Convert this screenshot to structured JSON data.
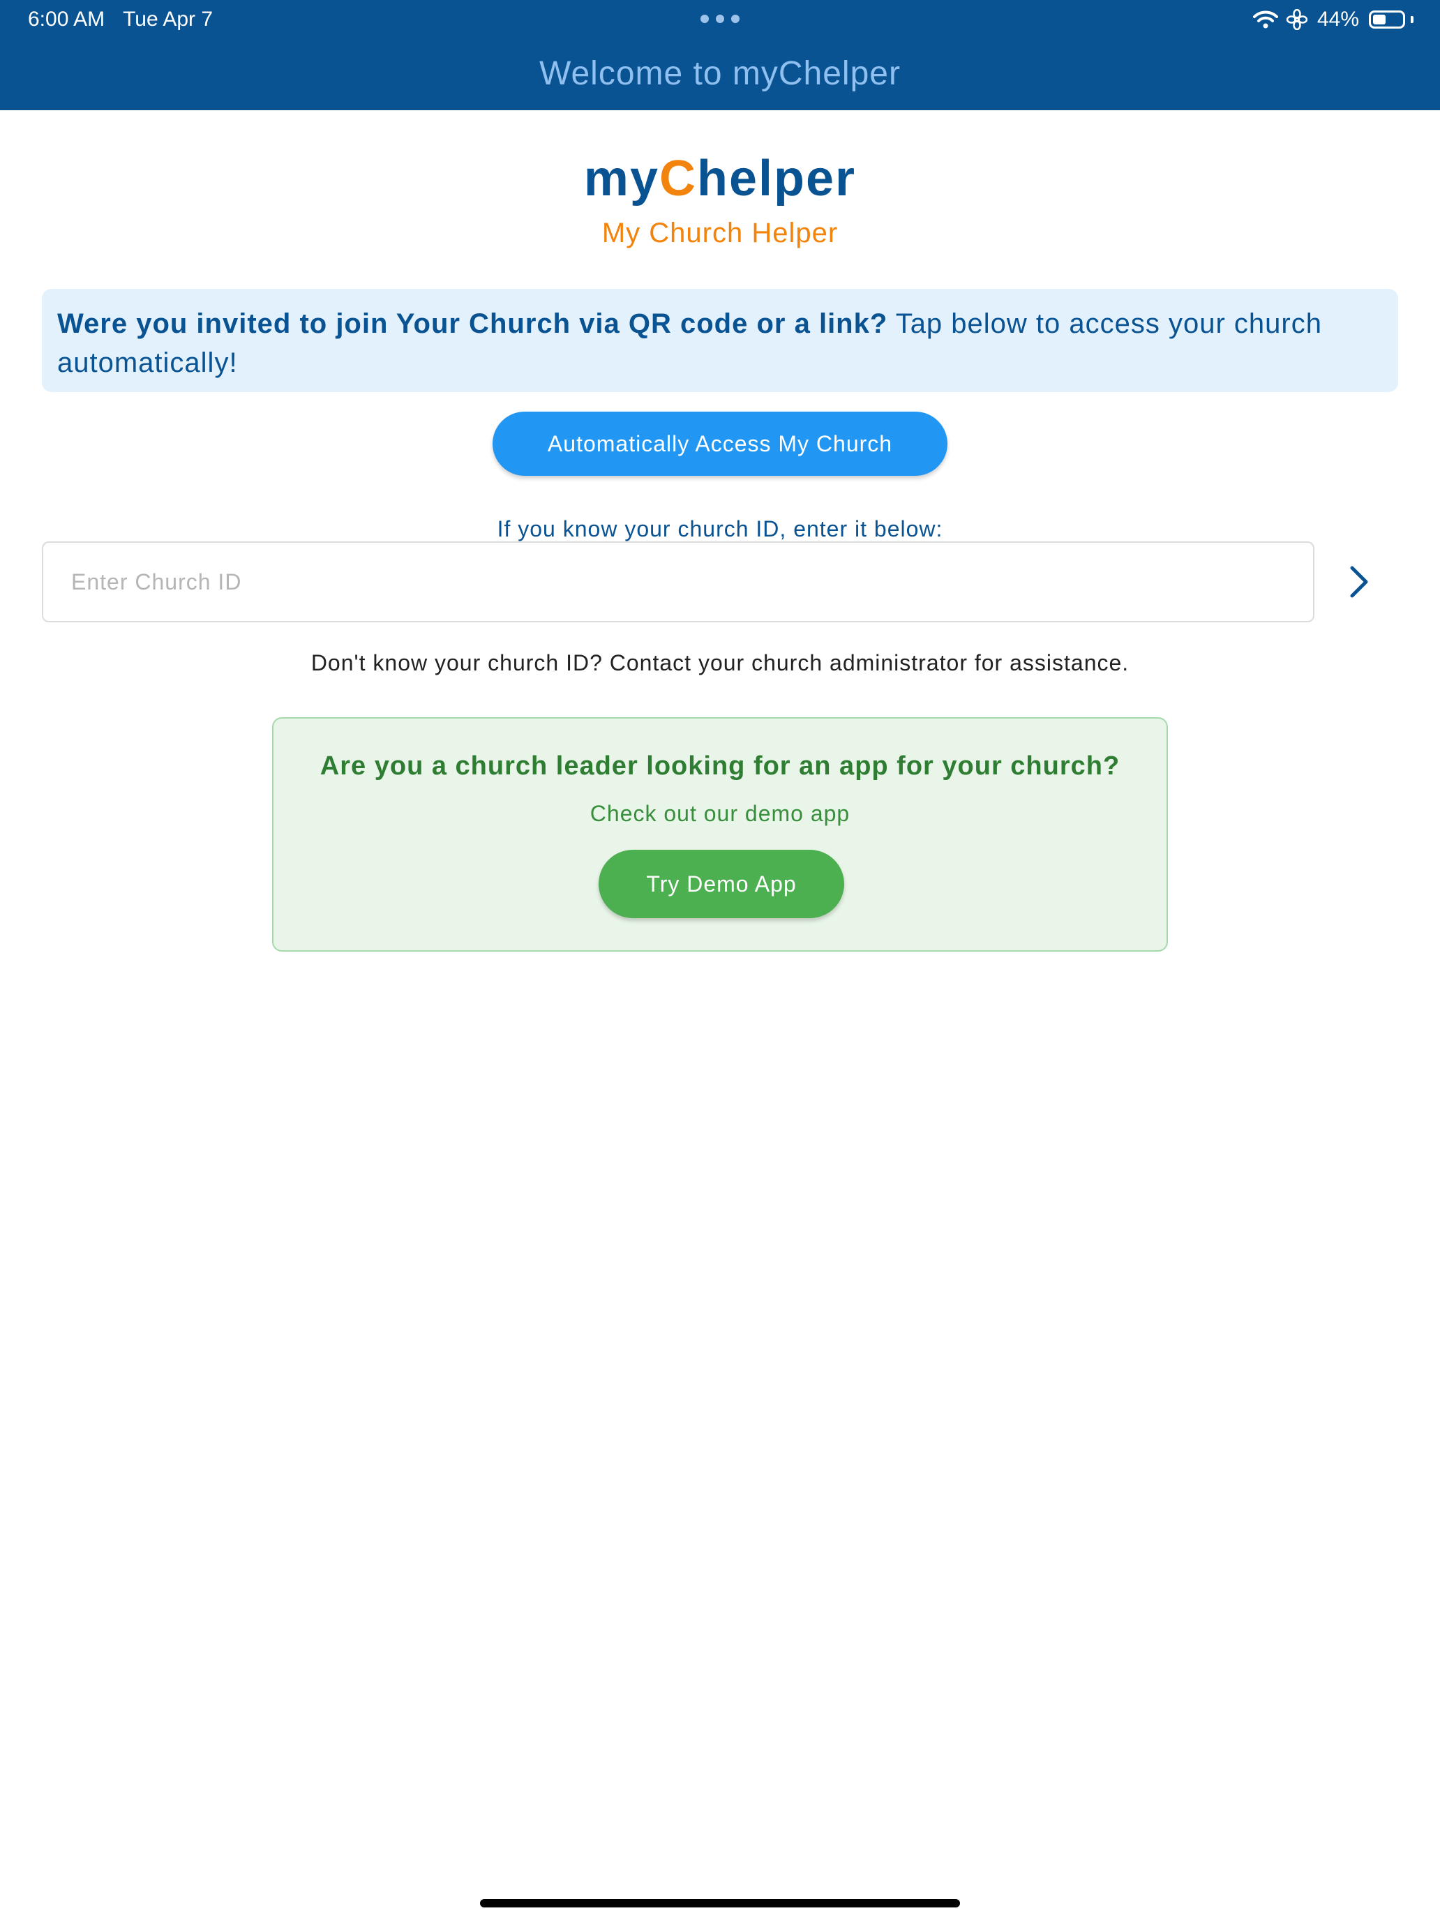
{
  "status_bar": {
    "time": "6:00 AM",
    "date": "Tue Apr 7",
    "battery_percent_label": "44%",
    "battery_level": 0.44,
    "icons": [
      "wifi-icon",
      "fan-icon",
      "battery-icon"
    ]
  },
  "header": {
    "title": "Welcome to myChelper"
  },
  "logo": {
    "part1": "my",
    "part2": "C",
    "part3": "helper",
    "tagline": "My Church Helper"
  },
  "invite": {
    "bold_text": "Were you invited to join Your Church via QR code or a link?",
    "regular_text": " Tap below to access your church automatically!",
    "button_label": "Automatically Access My Church"
  },
  "church_id": {
    "hint": "If you know your church ID, enter it below:",
    "placeholder": "Enter Church ID",
    "value": "",
    "help_text": "Don't know your church ID? Contact your church administrator for assistance."
  },
  "demo": {
    "heading": "Are you a church leader looking for an app for your church?",
    "subtext": "Check out our demo app",
    "button_label": "Try Demo App"
  },
  "colors": {
    "header_bg": "#0A5393",
    "brand_blue": "#0A5393",
    "brand_orange": "#F2840D",
    "primary_button": "#2196F3",
    "invite_bg": "#E3F1FC",
    "demo_bg": "#E8F5E8",
    "demo_text": "#2E7D32",
    "demo_button": "#4CAF50"
  }
}
